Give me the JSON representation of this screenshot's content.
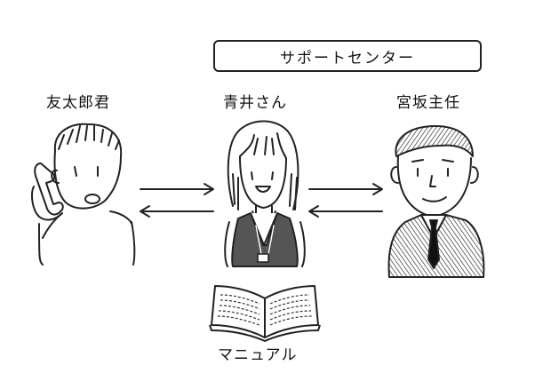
{
  "support_center_label": "サポートセンター",
  "people": {
    "customer": {
      "name": "友太郎君"
    },
    "operator": {
      "name": "青井さん"
    },
    "supervisor": {
      "name": "宮坂主任"
    }
  },
  "manual_label": "マニュアル",
  "colors": {
    "ink": "#222222",
    "vest": "#555555",
    "suit": "#6a6a6a",
    "tie": "#111111",
    "paper": "#ffffff"
  }
}
